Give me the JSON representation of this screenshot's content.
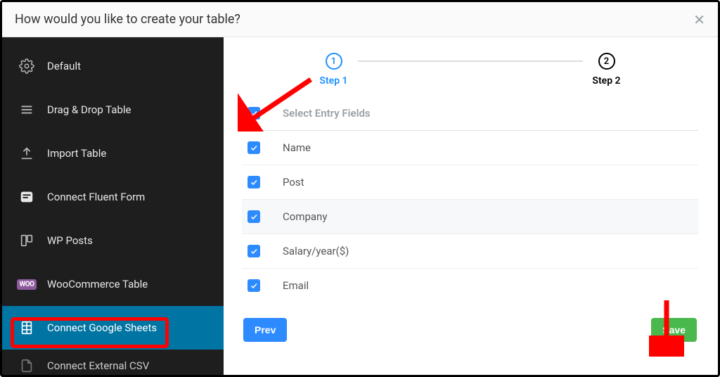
{
  "header": {
    "title": "How would you like to create your table?"
  },
  "sidebar": {
    "items": [
      {
        "label": "Default",
        "icon": "gear-icon"
      },
      {
        "label": "Drag & Drop Table",
        "icon": "drag-icon"
      },
      {
        "label": "Import Table",
        "icon": "upload-icon"
      },
      {
        "label": "Connect Fluent Form",
        "icon": "form-icon"
      },
      {
        "label": "WP Posts",
        "icon": "posts-icon"
      },
      {
        "label": "WooCommerce Table",
        "icon": "woo-badge"
      },
      {
        "label": "Connect Google Sheets",
        "icon": "sheet-icon"
      },
      {
        "label": "Connect External CSV",
        "icon": "file-icon"
      }
    ]
  },
  "stepper": {
    "step1": {
      "num": "1",
      "label": "Step 1"
    },
    "step2": {
      "num": "2",
      "label": "Step 2"
    }
  },
  "fields": {
    "header": "Select Entry Fields",
    "items": [
      {
        "label": "Name"
      },
      {
        "label": "Post"
      },
      {
        "label": "Company"
      },
      {
        "label": "Salary/year($)"
      },
      {
        "label": "Email"
      }
    ]
  },
  "footer": {
    "prev": "Prev",
    "save": "Save"
  },
  "woo_text": "WOO"
}
